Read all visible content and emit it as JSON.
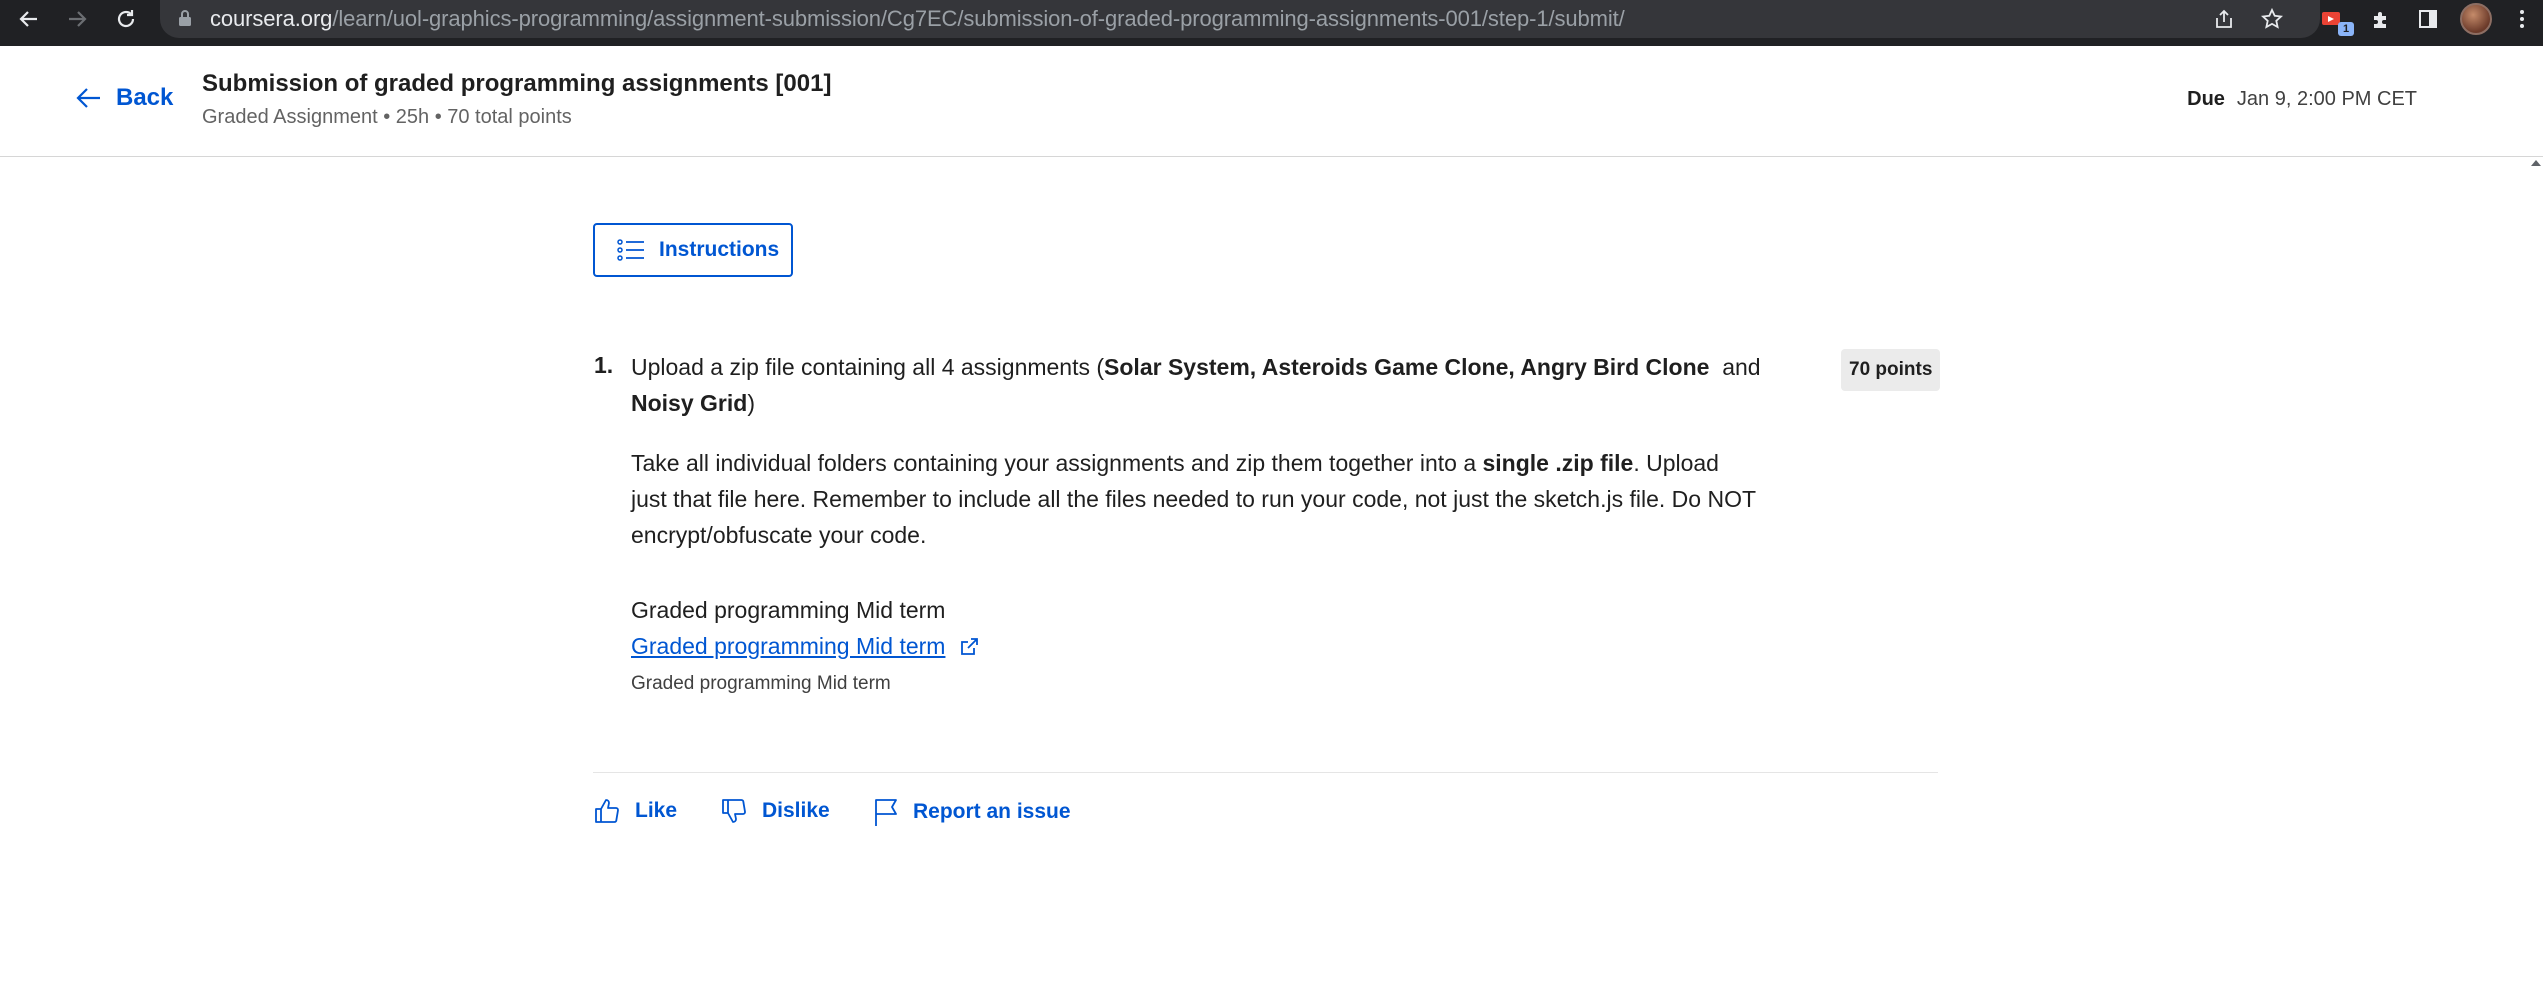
{
  "browser": {
    "url_host": "coursera.org",
    "url_path": "/learn/uol-graphics-programming/assignment-submission/Cg7EC/submission-of-graded-programming-assignments-001/step-1/submit/",
    "extension_badge": "1",
    "icons": [
      "back-arrow-icon",
      "forward-arrow-icon",
      "reload-icon",
      "lock-icon",
      "share-icon",
      "star-icon",
      "extension-icon",
      "puzzle-icon",
      "side-panel-icon",
      "avatar",
      "more-icon"
    ]
  },
  "header": {
    "back_label": "Back",
    "title": "Submission of graded programming assignments [001]",
    "subtitle": "Graded Assignment • 25h • 70 total points",
    "due_label": "Due",
    "due_value": "Jan 9, 2:00 PM CET"
  },
  "instructions_button": "Instructions",
  "question": {
    "number": "1.",
    "intro": "Upload a zip file containing all 4 assignments (",
    "bold_list": "Solar System, Asteroids Game Clone, Angry Bird Clone",
    "and_text": "and",
    "bold_last": "Noisy Grid",
    "close_paren": ")",
    "points": "70 points",
    "desc_part1": "Take all individual folders containing your assignments and zip them together into a ",
    "desc_bold": "single .zip file",
    "desc_part2": ". Upload just that file here. Remember to include all the files needed to run your code, not just the sketch.js file. Do NOT encrypt/obfuscate your code.",
    "file_label": "Graded programming Mid term",
    "file_link": "Graded programming Mid term",
    "file_caption": "Graded programming Mid term"
  },
  "actions": {
    "like": "Like",
    "dislike": "Dislike",
    "report": "Report an issue"
  },
  "colors": {
    "brand_blue": "#0056d2",
    "chrome_dark": "#202124",
    "points_bg": "#ebebeb"
  }
}
